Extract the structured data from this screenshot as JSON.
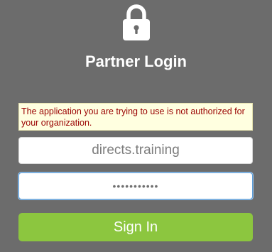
{
  "header": {
    "icon": "lock-icon",
    "title": "Partner Login"
  },
  "error": {
    "message": "The application you are trying to use is not authorized for your organization."
  },
  "form": {
    "username_value": "directs.training",
    "password_masked": "•••••••••••",
    "sign_in_label": "Sign In"
  },
  "colors": {
    "background": "#6c6c6c",
    "error_background": "#ffffe0",
    "error_text": "#990000",
    "button": "#8cc63f",
    "focus_border": "#5b9bd5"
  }
}
